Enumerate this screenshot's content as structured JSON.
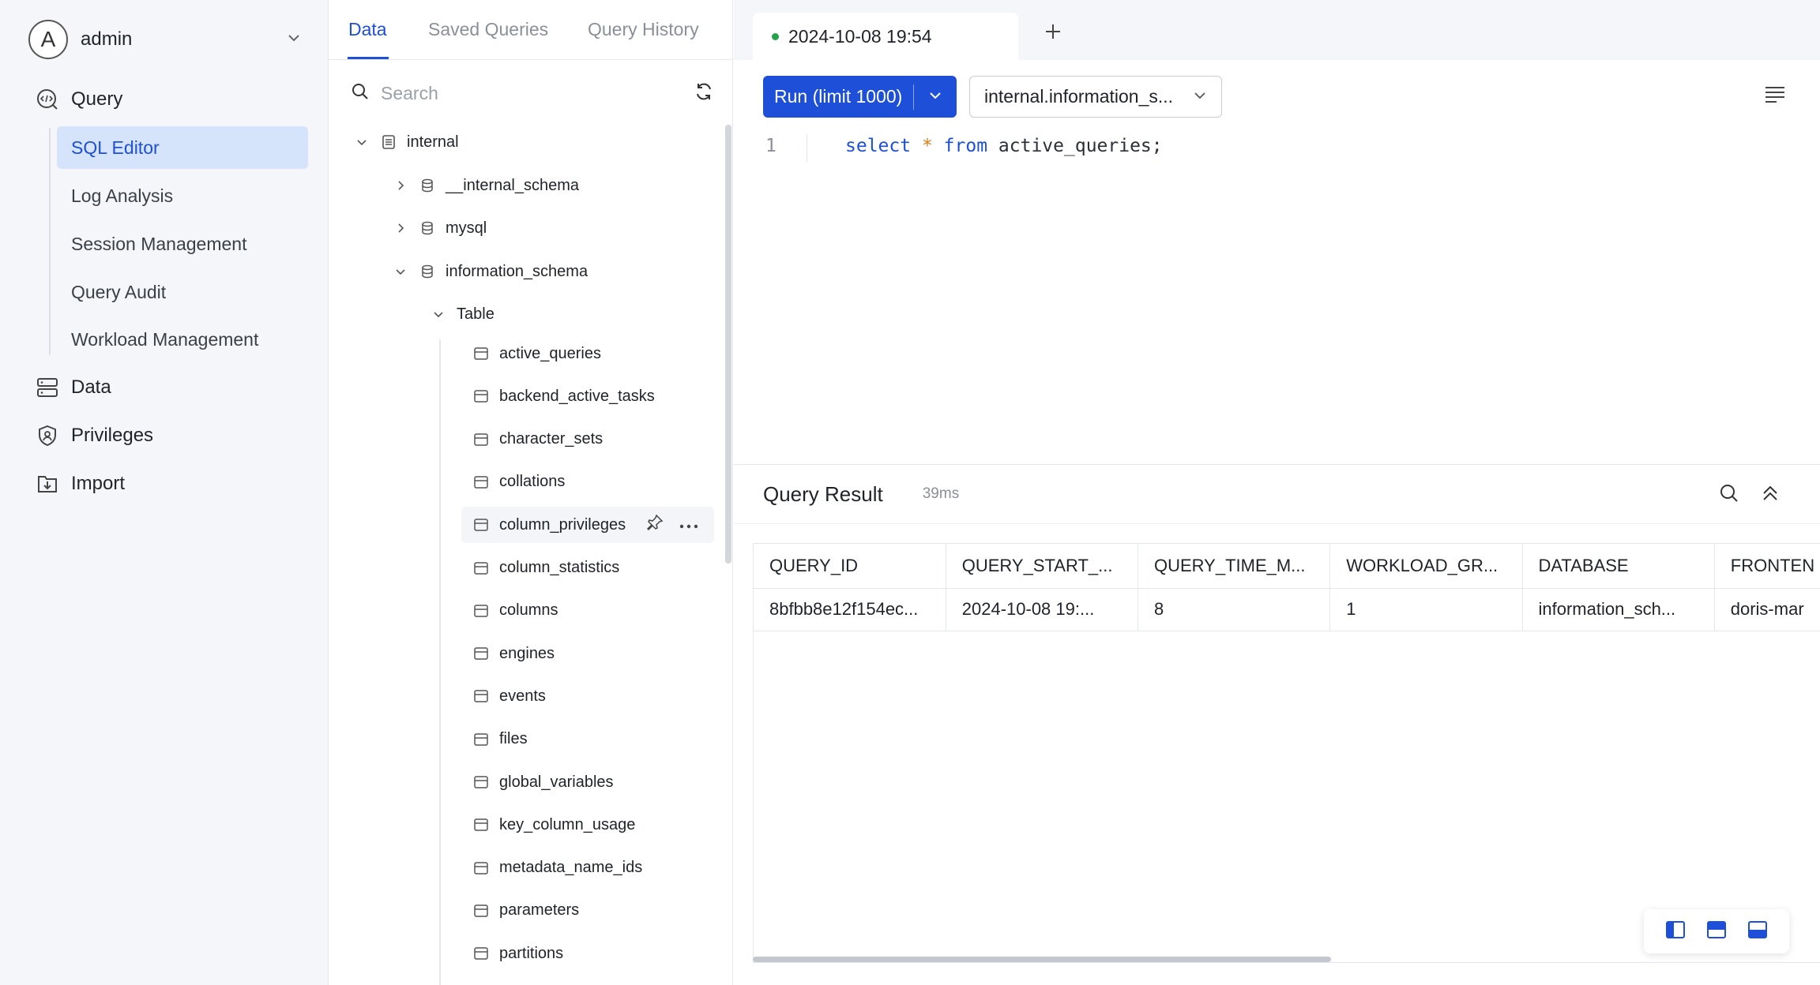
{
  "user": {
    "avatar_letter": "A",
    "name": "admin"
  },
  "nav": {
    "query": "Query",
    "sub": [
      "SQL Editor",
      "Log Analysis",
      "Session Management",
      "Query Audit",
      "Workload Management"
    ],
    "data": "Data",
    "privileges": "Privileges",
    "import": "Import"
  },
  "panel": {
    "tabs": [
      "Data",
      "Saved Queries",
      "Query History"
    ],
    "search_placeholder": "Search"
  },
  "tree": {
    "catalog": "internal",
    "schemas": [
      "__internal_schema",
      "mysql",
      "information_schema"
    ],
    "group": "Table",
    "tables": [
      "active_queries",
      "backend_active_tasks",
      "character_sets",
      "collations",
      "column_privileges",
      "column_statistics",
      "columns",
      "engines",
      "events",
      "files",
      "global_variables",
      "key_column_usage",
      "metadata_name_ids",
      "parameters",
      "partitions"
    ]
  },
  "editor": {
    "tab_title": "2024-10-08 19:54",
    "run_label": "Run (limit 1000)",
    "database": "internal.information_s...",
    "line_number": "1",
    "code": {
      "kw1": "select",
      "op": "*",
      "kw2": "from",
      "rest": "active_queries;"
    }
  },
  "result": {
    "title": "Query Result",
    "time": "39ms",
    "columns": [
      "QUERY_ID",
      "QUERY_START_...",
      "QUERY_TIME_M...",
      "WORKLOAD_GR...",
      "DATABASE",
      "FRONTEN"
    ],
    "rows": [
      [
        "8bfbb8e12f154ec...",
        "2024-10-08 19:...",
        "8",
        "1",
        "information_sch...",
        "doris-mar"
      ]
    ]
  },
  "colors": {
    "accent": "#1d4fd8",
    "status_dot": "#22a34a",
    "nav_bg": "#f4f6f9",
    "active_bg": "#d6e4fb"
  }
}
